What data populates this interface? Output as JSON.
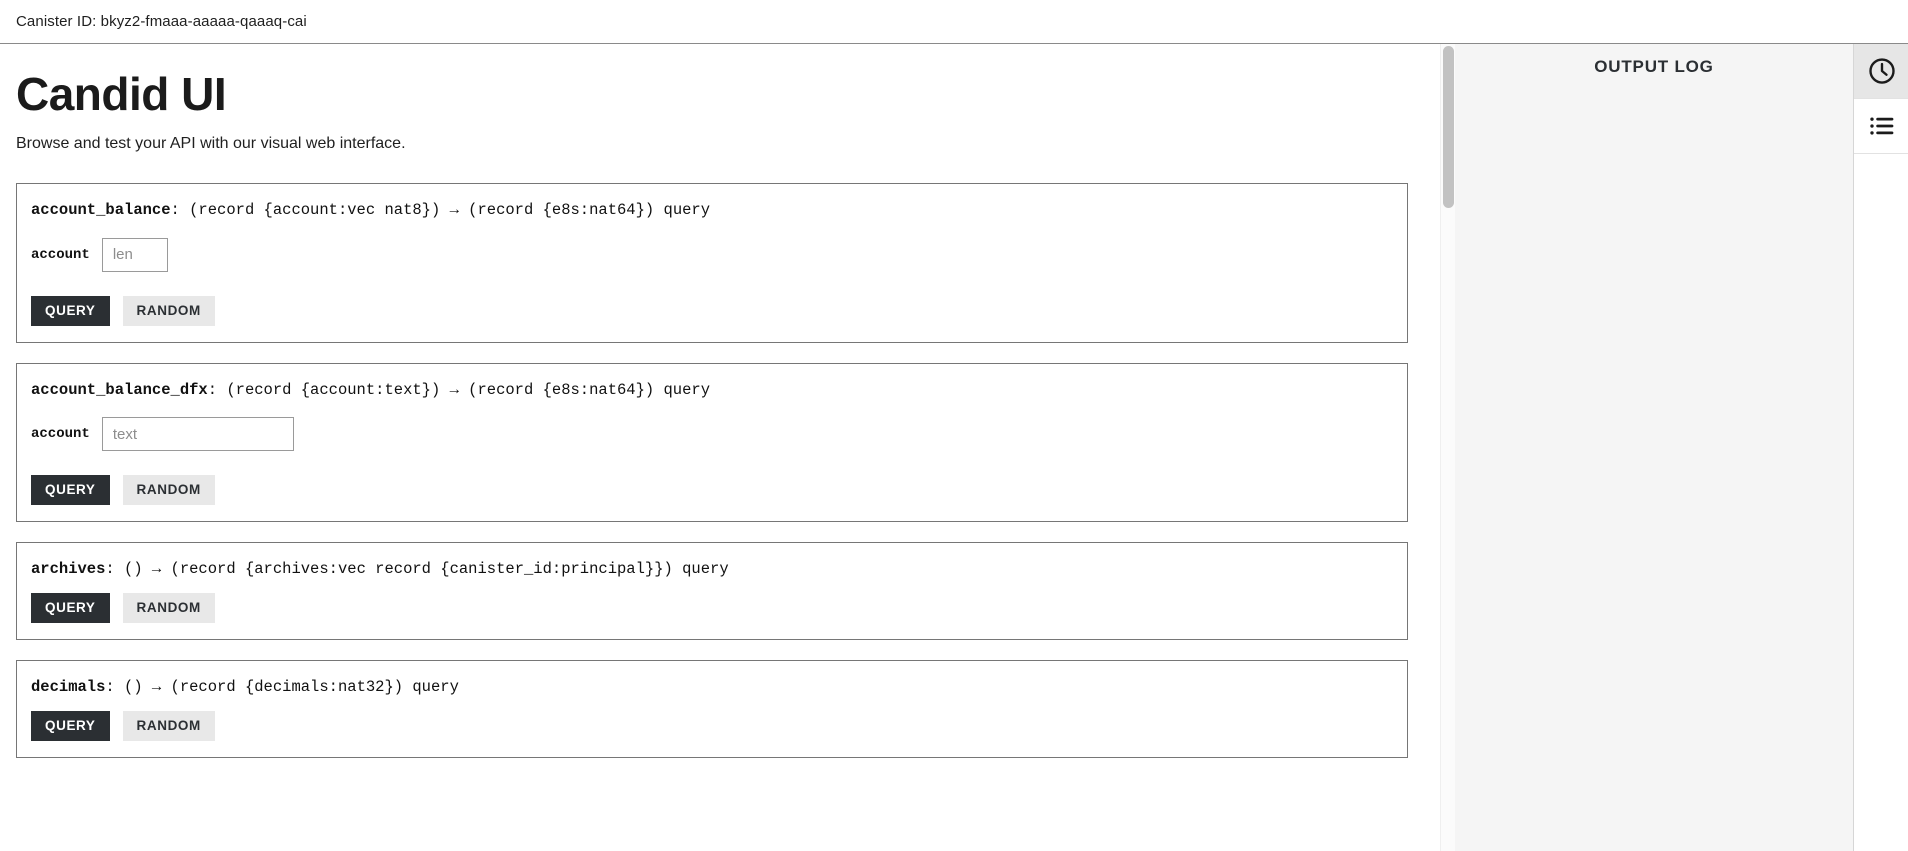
{
  "header": {
    "canister_id_label": "Canister ID: bkyz2-fmaaa-aaaaa-qaaaq-cai"
  },
  "main": {
    "title": "Candid UI",
    "subtitle": "Browse and test your API with our visual web interface.",
    "methods": [
      {
        "name": "account_balance",
        "signature_rest": ": (record {account:vec nat8}) → (record {e8s:nat64}) query",
        "args": [
          {
            "label": "account",
            "placeholder": "len",
            "value": ""
          }
        ],
        "query_label": "QUERY",
        "random_label": "RANDOM"
      },
      {
        "name": "account_balance_dfx",
        "signature_rest": ": (record {account:text}) → (record {e8s:nat64}) query",
        "args": [
          {
            "label": "account",
            "placeholder": "text",
            "value": ""
          }
        ],
        "query_label": "QUERY",
        "random_label": "RANDOM"
      },
      {
        "name": "archives",
        "signature_rest": ": () → (record {archives:vec record {canister_id:principal}}) query",
        "args": [],
        "query_label": "QUERY",
        "random_label": "RANDOM"
      },
      {
        "name": "decimals",
        "signature_rest": ": () → (record {decimals:nat32}) query",
        "args": [],
        "query_label": "QUERY",
        "random_label": "RANDOM"
      }
    ]
  },
  "output_log": {
    "title": "OUTPUT LOG",
    "entries": []
  },
  "icon_rail": {
    "buttons": [
      {
        "icon": "clock-icon",
        "active": true
      },
      {
        "icon": "list-icon",
        "active": false
      }
    ]
  },
  "colors": {
    "primary_button_bg": "#2b2f33",
    "secondary_button_bg": "#e8e8e8",
    "log_panel_bg": "#f5f5f5",
    "card_border": "#767676"
  }
}
